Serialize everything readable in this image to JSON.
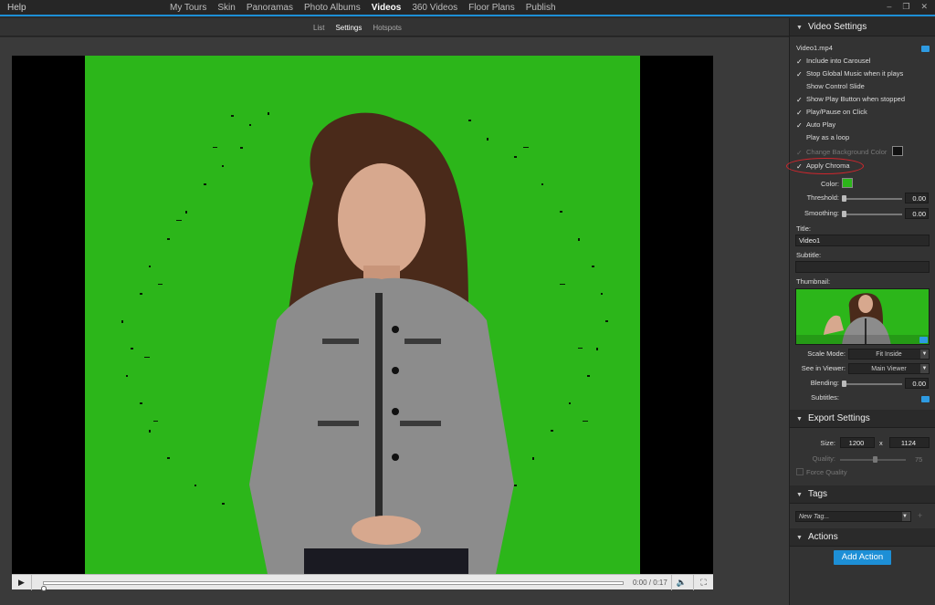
{
  "topbar": {
    "help": "Help",
    "nav": [
      {
        "label": "My Tours",
        "active": false
      },
      {
        "label": "Skin",
        "active": false
      },
      {
        "label": "Panoramas",
        "active": false
      },
      {
        "label": "Photo Albums",
        "active": false
      },
      {
        "label": "Videos",
        "active": true
      },
      {
        "label": "360 Videos",
        "active": false
      },
      {
        "label": "Floor Plans",
        "active": false
      },
      {
        "label": "Publish",
        "active": false
      }
    ],
    "window_controls": [
      "minimize-icon",
      "restore-icon",
      "close-icon"
    ]
  },
  "subtabs": [
    {
      "label": "List",
      "active": false
    },
    {
      "label": "Settings",
      "active": true
    },
    {
      "label": "Hotspots",
      "active": false
    }
  ],
  "player": {
    "time": "0:00 / 0:17",
    "progress": 0
  },
  "video_settings": {
    "header": "Video Settings",
    "file": "Video1.mp4",
    "checkboxes": [
      {
        "label": "Include into Carousel",
        "checked": true,
        "enabled": true
      },
      {
        "label": "Stop Global Music when it plays",
        "checked": true,
        "enabled": true
      },
      {
        "label": "Show Control Slide",
        "checked": false,
        "enabled": true
      },
      {
        "label": "Show Play Button when stopped",
        "checked": true,
        "enabled": true
      },
      {
        "label": "Play/Pause on Click",
        "checked": true,
        "enabled": true
      },
      {
        "label": "Auto Play",
        "checked": true,
        "enabled": true
      },
      {
        "label": "Play as a loop",
        "checked": false,
        "enabled": true
      },
      {
        "label": "Change Background Color",
        "checked": true,
        "enabled": false
      },
      {
        "label": "Apply Chroma",
        "checked": true,
        "enabled": true
      }
    ],
    "color_label": "Color:",
    "chroma_color": "#2cb61a",
    "background_color": "#111111",
    "threshold_label": "Threshold:",
    "threshold_value": "0.00",
    "smoothing_label": "Smoothing:",
    "smoothing_value": "0.00",
    "title_label": "Title:",
    "title_value": "Video1",
    "subtitle_label": "Subtitle:",
    "subtitle_value": "",
    "thumbnail_label": "Thumbnail:",
    "scale_mode_label": "Scale Mode:",
    "scale_mode_value": "Fit Inside",
    "see_in_viewer_label": "See in Viewer:",
    "see_in_viewer_value": "Main Viewer",
    "blending_label": "Blending:",
    "blending_value": "0.00",
    "subtitles_label": "Subtitles:"
  },
  "export_settings": {
    "header": "Export Settings",
    "size_label": "Size:",
    "width": "1200",
    "x": "x",
    "height": "1124",
    "quality_label": "Quality:",
    "quality_value": "75",
    "force_quality_label": "Force Quality"
  },
  "tags": {
    "header": "Tags",
    "placeholder": "New Tag..."
  },
  "actions": {
    "header": "Actions",
    "add_action": "Add Action"
  },
  "colors": {
    "accent": "#1d8fd6",
    "chroma_green": "#2cb61a",
    "highlight_red": "#d0262d"
  }
}
